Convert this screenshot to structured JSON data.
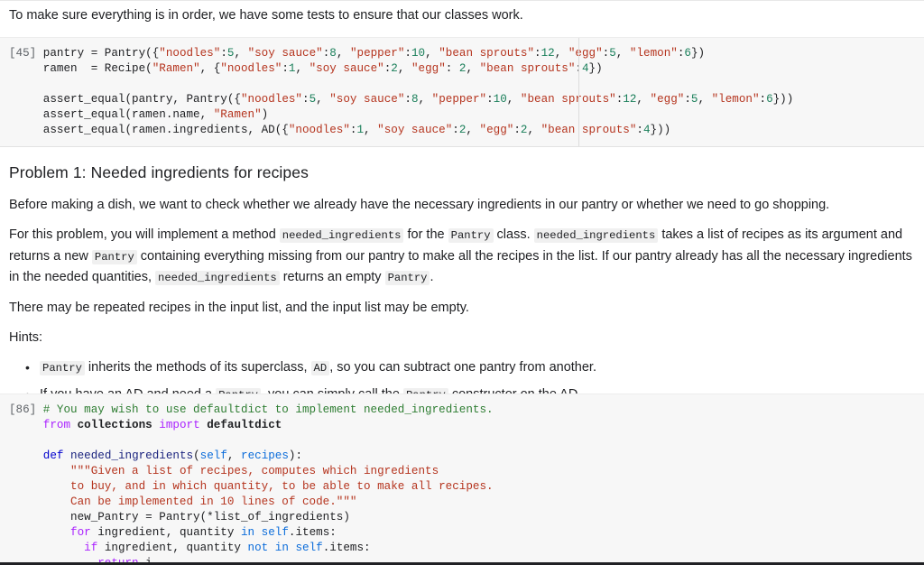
{
  "notebook": {
    "intro_paragraph": "To make sure everything is in order, we have some tests to ensure that our classes work.",
    "cell_1": {
      "prompt": "[45]",
      "lines": [
        "pantry = Pantry({\"noodles\":5, \"soy sauce\":8, \"pepper\":10, \"bean sprouts\":12, \"egg\":5, \"lemon\":6})",
        "ramen  = Recipe(\"Ramen\", {\"noodles\":1, \"soy sauce\":2, \"egg\": 2, \"bean sprouts\":4})",
        "",
        "assert_equal(pantry, Pantry({\"noodles\":5, \"soy sauce\":8, \"pepper\":10, \"bean sprouts\":12, \"egg\":5, \"lemon\":6}))",
        "assert_equal(ramen.name, \"Ramen\")",
        "assert_equal(ramen.ingredients, AD({\"noodles\":1, \"soy sauce\":2, \"egg\":2, \"bean sprouts\":4}))"
      ]
    },
    "problem": {
      "heading": "Problem 1: Needed ingredients for recipes",
      "p1": "Before making a dish, we want to check whether we already have the necessary ingredients in our pantry or whether we need to go shopping.",
      "p2_a": "For this problem, you will implement a method ",
      "p2_code1": "needed_ingredients",
      "p2_b": " for the ",
      "p2_code2": "Pantry",
      "p2_c": " class. ",
      "p2_code3": "needed_ingredients",
      "p2_d": " takes a list of recipes as its argument and returns a new ",
      "p2_code4": "Pantry",
      "p2_e": " containing everything missing from our pantry to make all the recipes in the list. If our pantry already has all the necessary ingredients in the needed quantities, ",
      "p2_code5": "needed_ingredients",
      "p2_f": " returns an empty ",
      "p2_code6": "Pantry",
      "p2_g": ".",
      "p3": "There may be repeated recipes in the input list, and the input list may be empty.",
      "hints_label": "Hints:",
      "hint1_code1": "Pantry",
      "hint1_a": " inherits the methods of its superclass, ",
      "hint1_code2": "AD",
      "hint1_b": ", so you can subtract one pantry from another.",
      "hint2_a": "If you have an AD and need a ",
      "hint2_code1": "Pantry",
      "hint2_b": ", you can simply call the ",
      "hint2_code2": "Pantry",
      "hint2_c": " constructor on the AD."
    },
    "cell_2": {
      "prompt": "[86]",
      "lines": [
        "# You may wish to use defaultdict to implement needed_ingredients.",
        "from collections import defaultdict",
        "",
        "def needed_ingredients(self, recipes):",
        "    \"\"\"Given a list of recipes, computes which ingredients",
        "    to buy, and in which quantity, to be able to make all recipes.",
        "    Can be implemented in 10 lines of code.\"\"\"",
        "    new_Pantry = Pantry(*list_of_ingredients)",
        "    for ingredient, quantity in self.items:",
        "      if ingredient, quantity not in self.items:",
        "        return i"
      ]
    }
  },
  "colors": {
    "cell_background": "#f7f7f7",
    "string": "#b5341e",
    "number": "#1a7f5a",
    "keyword": "#aa22ff",
    "comment": "#2e7d32",
    "builtin": "#0b6cda",
    "text": "#202124"
  }
}
